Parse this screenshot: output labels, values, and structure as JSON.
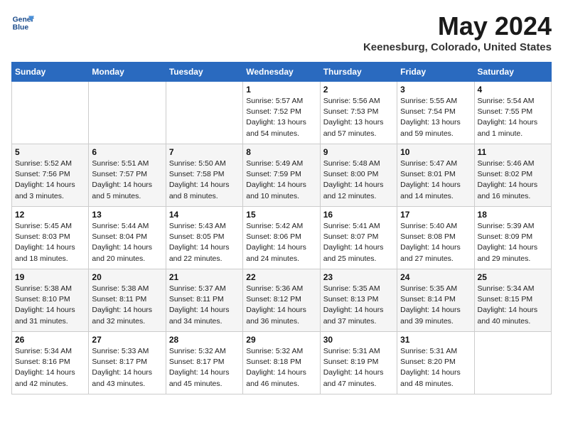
{
  "header": {
    "logo_line1": "General",
    "logo_line2": "Blue",
    "title": "May 2024",
    "subtitle": "Keenesburg, Colorado, United States"
  },
  "weekdays": [
    "Sunday",
    "Monday",
    "Tuesday",
    "Wednesday",
    "Thursday",
    "Friday",
    "Saturday"
  ],
  "weeks": [
    [
      {
        "day": "",
        "info": ""
      },
      {
        "day": "",
        "info": ""
      },
      {
        "day": "",
        "info": ""
      },
      {
        "day": "1",
        "info": "Sunrise: 5:57 AM\nSunset: 7:52 PM\nDaylight: 13 hours\nand 54 minutes."
      },
      {
        "day": "2",
        "info": "Sunrise: 5:56 AM\nSunset: 7:53 PM\nDaylight: 13 hours\nand 57 minutes."
      },
      {
        "day": "3",
        "info": "Sunrise: 5:55 AM\nSunset: 7:54 PM\nDaylight: 13 hours\nand 59 minutes."
      },
      {
        "day": "4",
        "info": "Sunrise: 5:54 AM\nSunset: 7:55 PM\nDaylight: 14 hours\nand 1 minute."
      }
    ],
    [
      {
        "day": "5",
        "info": "Sunrise: 5:52 AM\nSunset: 7:56 PM\nDaylight: 14 hours\nand 3 minutes."
      },
      {
        "day": "6",
        "info": "Sunrise: 5:51 AM\nSunset: 7:57 PM\nDaylight: 14 hours\nand 5 minutes."
      },
      {
        "day": "7",
        "info": "Sunrise: 5:50 AM\nSunset: 7:58 PM\nDaylight: 14 hours\nand 8 minutes."
      },
      {
        "day": "8",
        "info": "Sunrise: 5:49 AM\nSunset: 7:59 PM\nDaylight: 14 hours\nand 10 minutes."
      },
      {
        "day": "9",
        "info": "Sunrise: 5:48 AM\nSunset: 8:00 PM\nDaylight: 14 hours\nand 12 minutes."
      },
      {
        "day": "10",
        "info": "Sunrise: 5:47 AM\nSunset: 8:01 PM\nDaylight: 14 hours\nand 14 minutes."
      },
      {
        "day": "11",
        "info": "Sunrise: 5:46 AM\nSunset: 8:02 PM\nDaylight: 14 hours\nand 16 minutes."
      }
    ],
    [
      {
        "day": "12",
        "info": "Sunrise: 5:45 AM\nSunset: 8:03 PM\nDaylight: 14 hours\nand 18 minutes."
      },
      {
        "day": "13",
        "info": "Sunrise: 5:44 AM\nSunset: 8:04 PM\nDaylight: 14 hours\nand 20 minutes."
      },
      {
        "day": "14",
        "info": "Sunrise: 5:43 AM\nSunset: 8:05 PM\nDaylight: 14 hours\nand 22 minutes."
      },
      {
        "day": "15",
        "info": "Sunrise: 5:42 AM\nSunset: 8:06 PM\nDaylight: 14 hours\nand 24 minutes."
      },
      {
        "day": "16",
        "info": "Sunrise: 5:41 AM\nSunset: 8:07 PM\nDaylight: 14 hours\nand 25 minutes."
      },
      {
        "day": "17",
        "info": "Sunrise: 5:40 AM\nSunset: 8:08 PM\nDaylight: 14 hours\nand 27 minutes."
      },
      {
        "day": "18",
        "info": "Sunrise: 5:39 AM\nSunset: 8:09 PM\nDaylight: 14 hours\nand 29 minutes."
      }
    ],
    [
      {
        "day": "19",
        "info": "Sunrise: 5:38 AM\nSunset: 8:10 PM\nDaylight: 14 hours\nand 31 minutes."
      },
      {
        "day": "20",
        "info": "Sunrise: 5:38 AM\nSunset: 8:11 PM\nDaylight: 14 hours\nand 32 minutes."
      },
      {
        "day": "21",
        "info": "Sunrise: 5:37 AM\nSunset: 8:11 PM\nDaylight: 14 hours\nand 34 minutes."
      },
      {
        "day": "22",
        "info": "Sunrise: 5:36 AM\nSunset: 8:12 PM\nDaylight: 14 hours\nand 36 minutes."
      },
      {
        "day": "23",
        "info": "Sunrise: 5:35 AM\nSunset: 8:13 PM\nDaylight: 14 hours\nand 37 minutes."
      },
      {
        "day": "24",
        "info": "Sunrise: 5:35 AM\nSunset: 8:14 PM\nDaylight: 14 hours\nand 39 minutes."
      },
      {
        "day": "25",
        "info": "Sunrise: 5:34 AM\nSunset: 8:15 PM\nDaylight: 14 hours\nand 40 minutes."
      }
    ],
    [
      {
        "day": "26",
        "info": "Sunrise: 5:34 AM\nSunset: 8:16 PM\nDaylight: 14 hours\nand 42 minutes."
      },
      {
        "day": "27",
        "info": "Sunrise: 5:33 AM\nSunset: 8:17 PM\nDaylight: 14 hours\nand 43 minutes."
      },
      {
        "day": "28",
        "info": "Sunrise: 5:32 AM\nSunset: 8:17 PM\nDaylight: 14 hours\nand 45 minutes."
      },
      {
        "day": "29",
        "info": "Sunrise: 5:32 AM\nSunset: 8:18 PM\nDaylight: 14 hours\nand 46 minutes."
      },
      {
        "day": "30",
        "info": "Sunrise: 5:31 AM\nSunset: 8:19 PM\nDaylight: 14 hours\nand 47 minutes."
      },
      {
        "day": "31",
        "info": "Sunrise: 5:31 AM\nSunset: 8:20 PM\nDaylight: 14 hours\nand 48 minutes."
      },
      {
        "day": "",
        "info": ""
      }
    ]
  ]
}
